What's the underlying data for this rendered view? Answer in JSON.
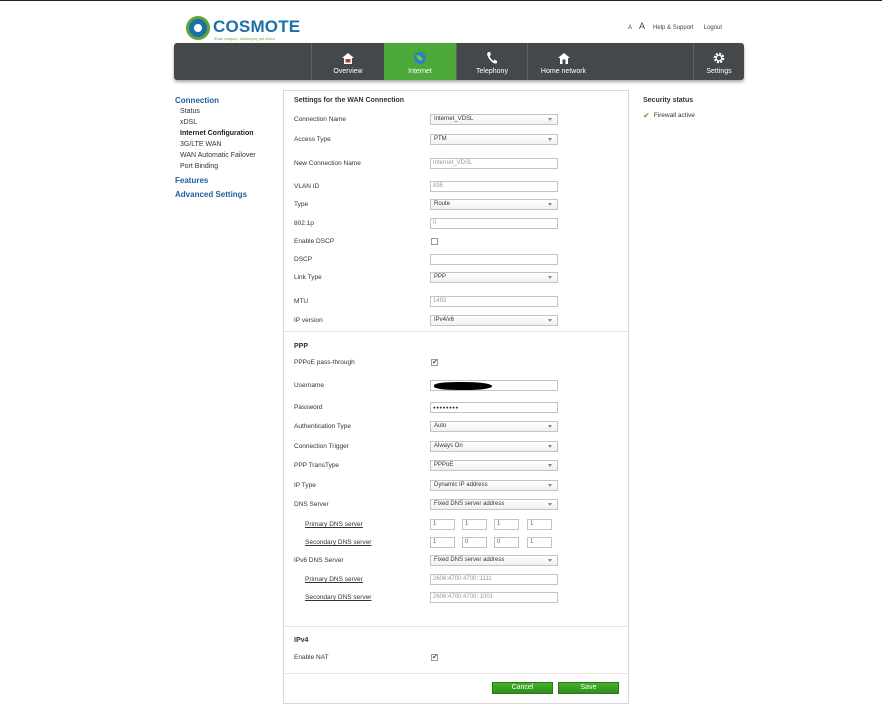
{
  "brand": {
    "name": "COSMOTE",
    "tagline": "Ένας κόσμος, καλύτερος για όλους"
  },
  "toplinks": {
    "font_small": "A",
    "font_large": "A",
    "help": "Help & Support",
    "logout": "Logout"
  },
  "nav": [
    {
      "label": "Overview",
      "icon": "home-icon"
    },
    {
      "label": "Internet",
      "icon": "globe-icon",
      "active": true
    },
    {
      "label": "Telephony",
      "icon": "phone-icon"
    },
    {
      "label": "Home network",
      "icon": "network-house-icon"
    },
    {
      "label": "Settings",
      "icon": "gear-icon"
    }
  ],
  "sidebar": {
    "connection": "Connection",
    "items": [
      "Status",
      "xDSL",
      "Internet Configuration",
      "3G/LTE WAN",
      "WAN Automatic Failover",
      "Port Binding"
    ],
    "features": "Features",
    "advanced": "Advanced Settings"
  },
  "form": {
    "title": "Settings for the WAN Connection",
    "connection_name": {
      "label": "Connection Name",
      "value": "Internet_VDSL"
    },
    "access_type": {
      "label": "Access Type",
      "value": "PTM"
    },
    "new_connection_name": {
      "label": "New Connection Name",
      "placeholder": "Internet_VDSL"
    },
    "vlan_id": {
      "label": "VLAN ID",
      "value": "835"
    },
    "type": {
      "label": "Type",
      "value": "Route"
    },
    "p8021": {
      "label": "802.1p",
      "value": "0"
    },
    "enable_dscp": {
      "label": "Enable DSCP",
      "checked": false
    },
    "dscp": {
      "label": "DSCP",
      "value": ""
    },
    "link_type": {
      "label": "Link Type",
      "value": "PPP"
    },
    "mtu": {
      "label": "MTU",
      "value": "1492"
    },
    "ip_version": {
      "label": "IP version",
      "value": "IPv4/v6"
    }
  },
  "ppp": {
    "title": "PPP",
    "passthrough": {
      "label": "PPPoE pass-through",
      "checked": true
    },
    "username": {
      "label": "Username"
    },
    "password": {
      "label": "Password",
      "value": "●●●●●●●●"
    },
    "auth_type": {
      "label": "Authentication Type",
      "value": "Auto"
    },
    "trigger": {
      "label": "Connection Trigger",
      "value": "Always On"
    },
    "transtype": {
      "label": "PPP TransType",
      "value": "PPPoE"
    },
    "ip_type": {
      "label": "IP Type",
      "value": "Dynamic IP address"
    },
    "dns_server": {
      "label": "DNS Server",
      "value": "Fixed DNS server address"
    },
    "primary_dns": {
      "label": "Primary DNS server",
      "octets": [
        "1",
        "1",
        "1",
        "1"
      ]
    },
    "secondary_dns": {
      "label": "Secondary DNS server",
      "octets": [
        "1",
        "0",
        "0",
        "1"
      ]
    },
    "ipv6_dns": {
      "label": "IPv6 DNS Server",
      "value": "Fixed DNS server address"
    },
    "primary_dns6": {
      "label": "Primary DNS server",
      "value": "2606:4700:4700::1111"
    },
    "secondary_dns6": {
      "label": "Secondary DNS server",
      "value": "2606:4700:4700::1001"
    }
  },
  "ipv4": {
    "title": "IPv4",
    "enable_nat": {
      "label": "Enable NAT",
      "checked": true
    }
  },
  "buttons": {
    "cancel": "Cancel",
    "save": "Save"
  },
  "security": {
    "title": "Security status",
    "firewall": "Firewall active"
  }
}
